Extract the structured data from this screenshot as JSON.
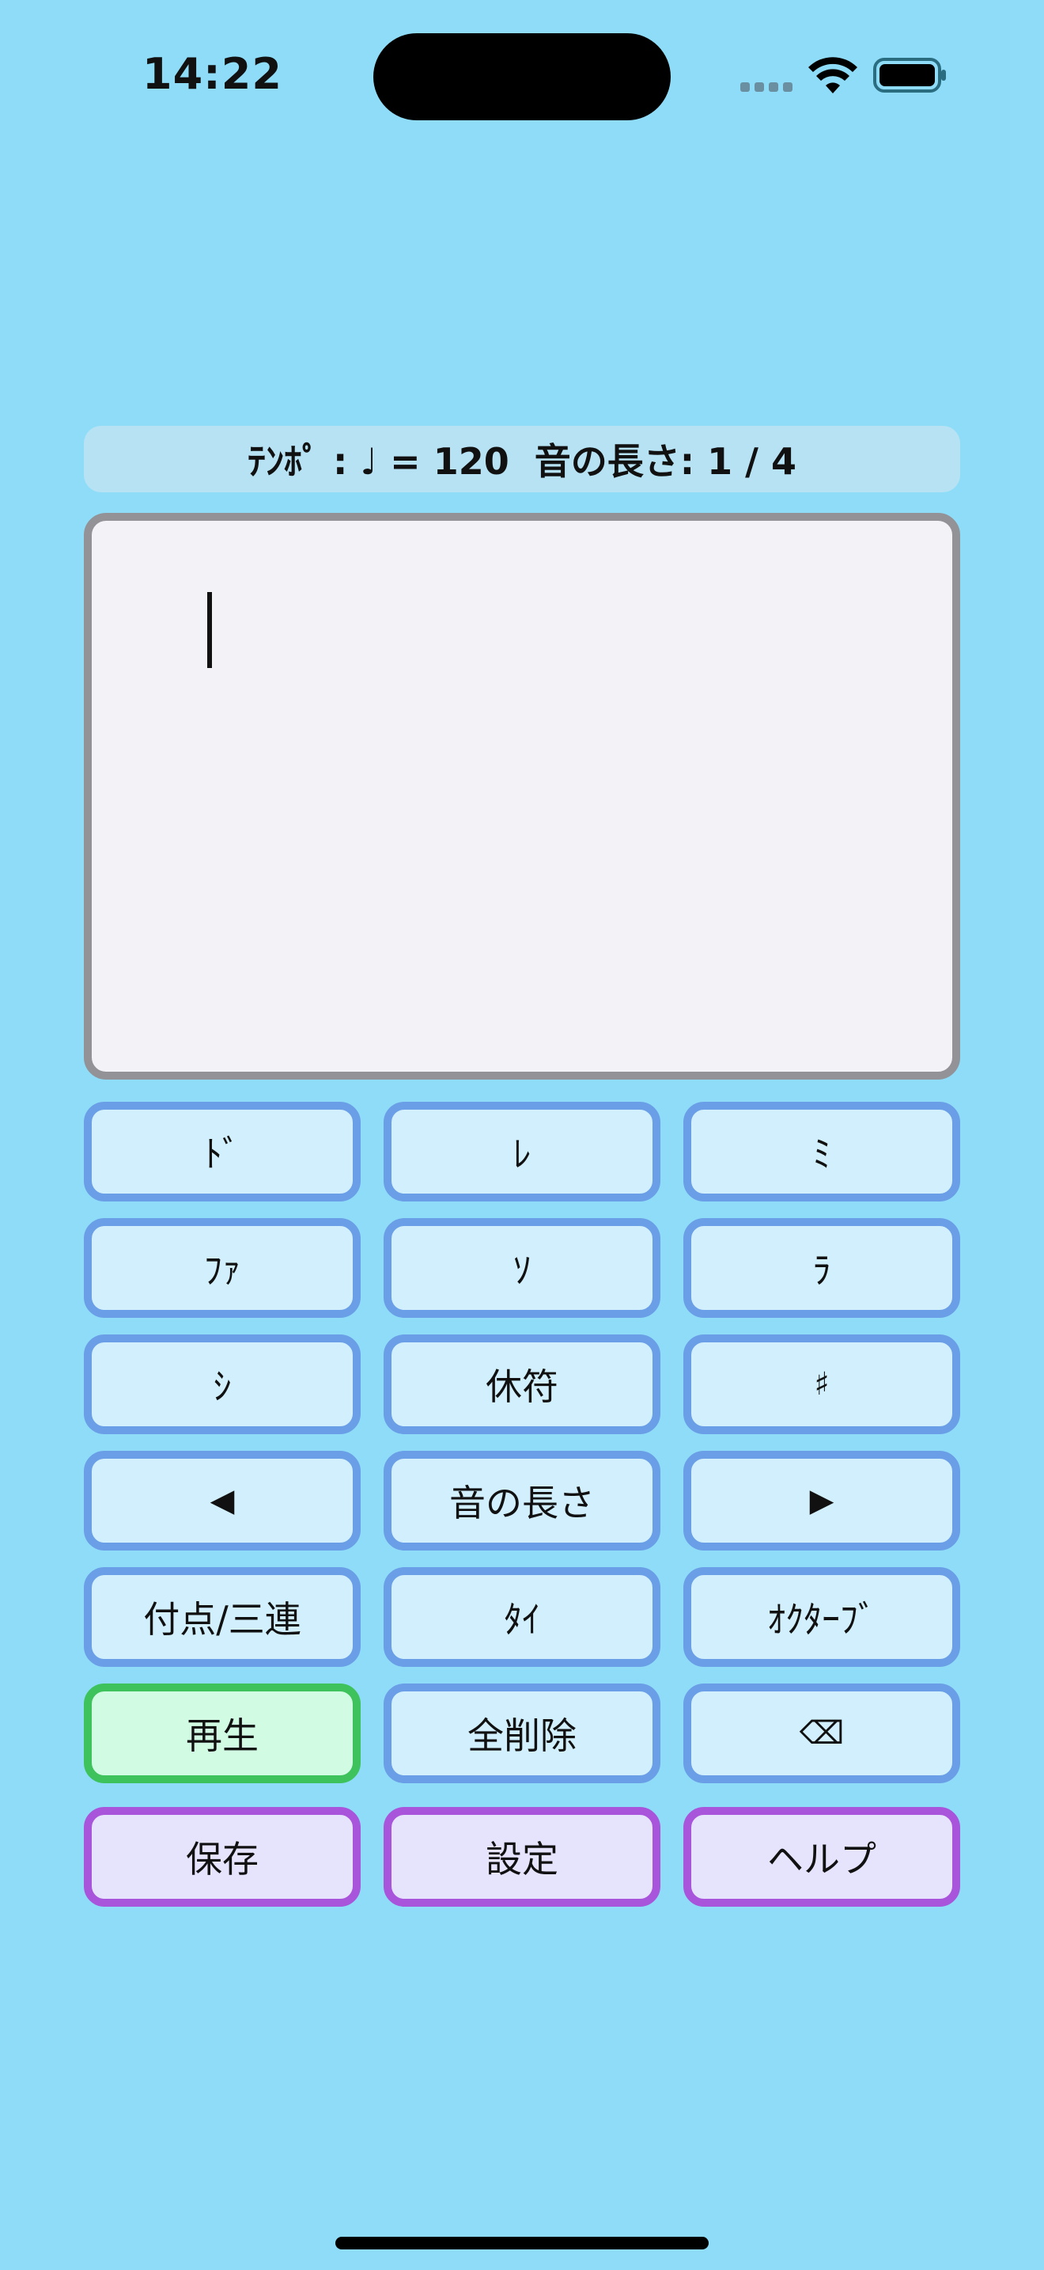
{
  "status_bar": {
    "time": "14:22",
    "icons": [
      "signal-icon",
      "wifi-icon",
      "battery-icon"
    ]
  },
  "info_bar": {
    "text": "ﾃﾝﾎﾟ : ♩ = 120  音の長さ: 1 / 4"
  },
  "editor": {
    "content": ""
  },
  "keypad": {
    "do": "ﾄﾞ",
    "re": "ﾚ",
    "mi": "ﾐ",
    "fa": "ﾌｧ",
    "so": "ｿ",
    "la": "ﾗ",
    "si": "ｼ",
    "rest": "休符",
    "sharp": "♯",
    "left": "◀",
    "note_length": "音の長さ",
    "right": "▶",
    "dot_triplet": "付点/三連",
    "tie": "ﾀｲ",
    "octave": "ｵｸﾀｰﾌﾞ",
    "play": "再生",
    "clear_all": "全削除",
    "backspace": "⌫"
  },
  "bottom_actions": {
    "save": "保存",
    "settings": "設定",
    "help": "ヘルプ"
  },
  "colors": {
    "background": "#8edcf8",
    "key_border": "#6a9ee6",
    "key_fill": "#d1effc",
    "play_border": "#3ec25c",
    "play_fill": "#d1fbe3",
    "util_border": "#a854db",
    "util_fill": "#e6e3fd",
    "editor_border": "#929297",
    "editor_fill": "#f3f2f7"
  }
}
